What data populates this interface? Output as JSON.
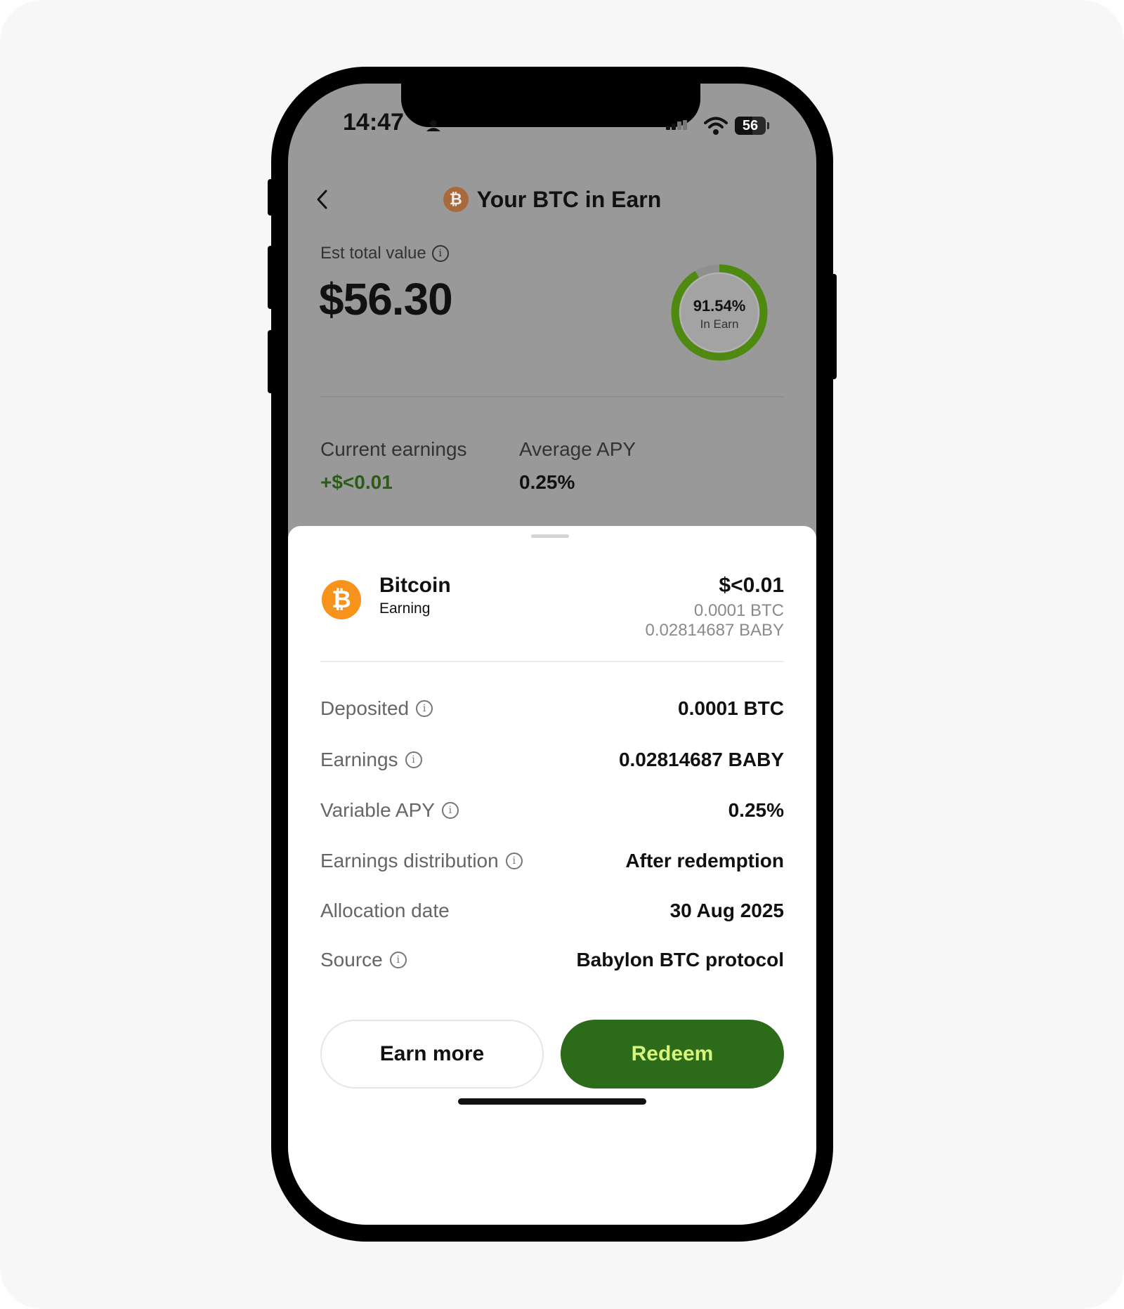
{
  "status_bar": {
    "time": "14:47",
    "battery": "56",
    "battery_level": 0.56
  },
  "header": {
    "title": "Your BTC in Earn",
    "coin_glyph": "₿",
    "back_icon": "chevron-left-icon"
  },
  "summary": {
    "est_label": "Est total value",
    "est_value": "$56.30",
    "ring_percent_text": "91.54%",
    "ring_percent": 91.54,
    "ring_sub": "In Earn",
    "current_earnings_label": "Current earnings",
    "current_earnings_value": "+$<0.01",
    "average_apy_label": "Average APY",
    "average_apy_value": "0.25%"
  },
  "asset": {
    "name": "Bitcoin",
    "status": "Earning",
    "usd": "$<0.01",
    "btc": "0.0001 BTC",
    "baby": "0.02814687 BABY",
    "glyph": "₿"
  },
  "details": [
    {
      "label": "Deposited",
      "value": "0.0001 BTC",
      "info": true
    },
    {
      "label": "Earnings",
      "value": "0.02814687 BABY",
      "info": true
    },
    {
      "label": "Variable APY",
      "value": "0.25%",
      "info": true
    },
    {
      "label": "Earnings distribution",
      "value": "After redemption",
      "info": true
    },
    {
      "label": "Allocation date",
      "value": "30 Aug 2025",
      "info": false
    },
    {
      "label": "Source",
      "value": "Babylon BTC protocol",
      "info": true
    }
  ],
  "actions": {
    "earn_more": "Earn more",
    "redeem": "Redeem"
  },
  "colors": {
    "accent_green": "#2b6b1a",
    "redeem_text": "#d6f57a",
    "ring_green": "#4f8a10",
    "bitcoin_orange": "#f7931a"
  }
}
